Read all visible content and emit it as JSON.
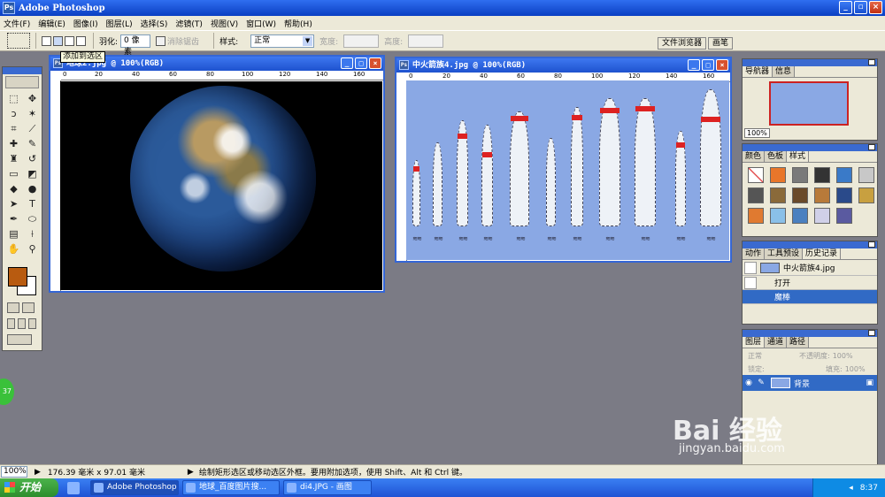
{
  "window": {
    "title": "Adobe Photoshop"
  },
  "menu": [
    "文件(F)",
    "编辑(E)",
    "图像(I)",
    "图层(L)",
    "选择(S)",
    "滤镜(T)",
    "视图(V)",
    "窗口(W)",
    "帮助(H)"
  ],
  "options": {
    "feather_label": "羽化:",
    "feather_value": "0 像素",
    "antialias_label": "消除锯齿",
    "style_label": "样式:",
    "style_value": "正常",
    "width_label": "宽度:",
    "height_label": "高度:",
    "file_browser": "文件浏览器",
    "brushes": "画笔"
  },
  "tooltip": "添加到选区",
  "doc_earth": {
    "title": "地球2.jpg @ 100%(RGB)"
  },
  "doc_rocket": {
    "title": "中火箭族4.jpg @ 100%(RGB)"
  },
  "ruler_earth": [
    "0",
    "20",
    "40",
    "60",
    "80",
    "100",
    "120",
    "140",
    "160"
  ],
  "ruler_rocket": [
    "0",
    "20",
    "40",
    "60",
    "80",
    "100",
    "120",
    "140",
    "160"
  ],
  "navigator": {
    "tabs": [
      "导航器",
      "信息"
    ],
    "zoom": "100%"
  },
  "swatches": {
    "tabs": [
      "颜色",
      "色板",
      "样式"
    ]
  },
  "history": {
    "tabs": [
      "动作",
      "工具预设",
      "历史记录"
    ],
    "snapshot": "中火箭族4.jpg",
    "items": [
      "打开",
      "魔棒"
    ]
  },
  "layers": {
    "tabs": [
      "图层",
      "通道",
      "路径"
    ],
    "blend": "正常",
    "opacity_label": "不透明度:",
    "opacity_value": "100%",
    "lock_label": "锁定:",
    "fill_label": "填充:",
    "fill_value": "100%",
    "layer_name": "背景"
  },
  "status": {
    "zoom": "100%",
    "size": "176.39 毫米 x 97.01 毫米",
    "hint": "绘制矩形选区或移动选区外框。要用附加选项，使用 Shift、Alt 和 Ctrl 键。"
  },
  "taskbar": {
    "start": "开始",
    "tasks": [
      "Adobe Photoshop",
      "地球_百度图片搜...",
      "di4.JPG - 画图"
    ],
    "clock": "8:37"
  },
  "watermark": {
    "brand": "Bai 经验",
    "url": "jingyan.baidu.com"
  },
  "badge": "37"
}
